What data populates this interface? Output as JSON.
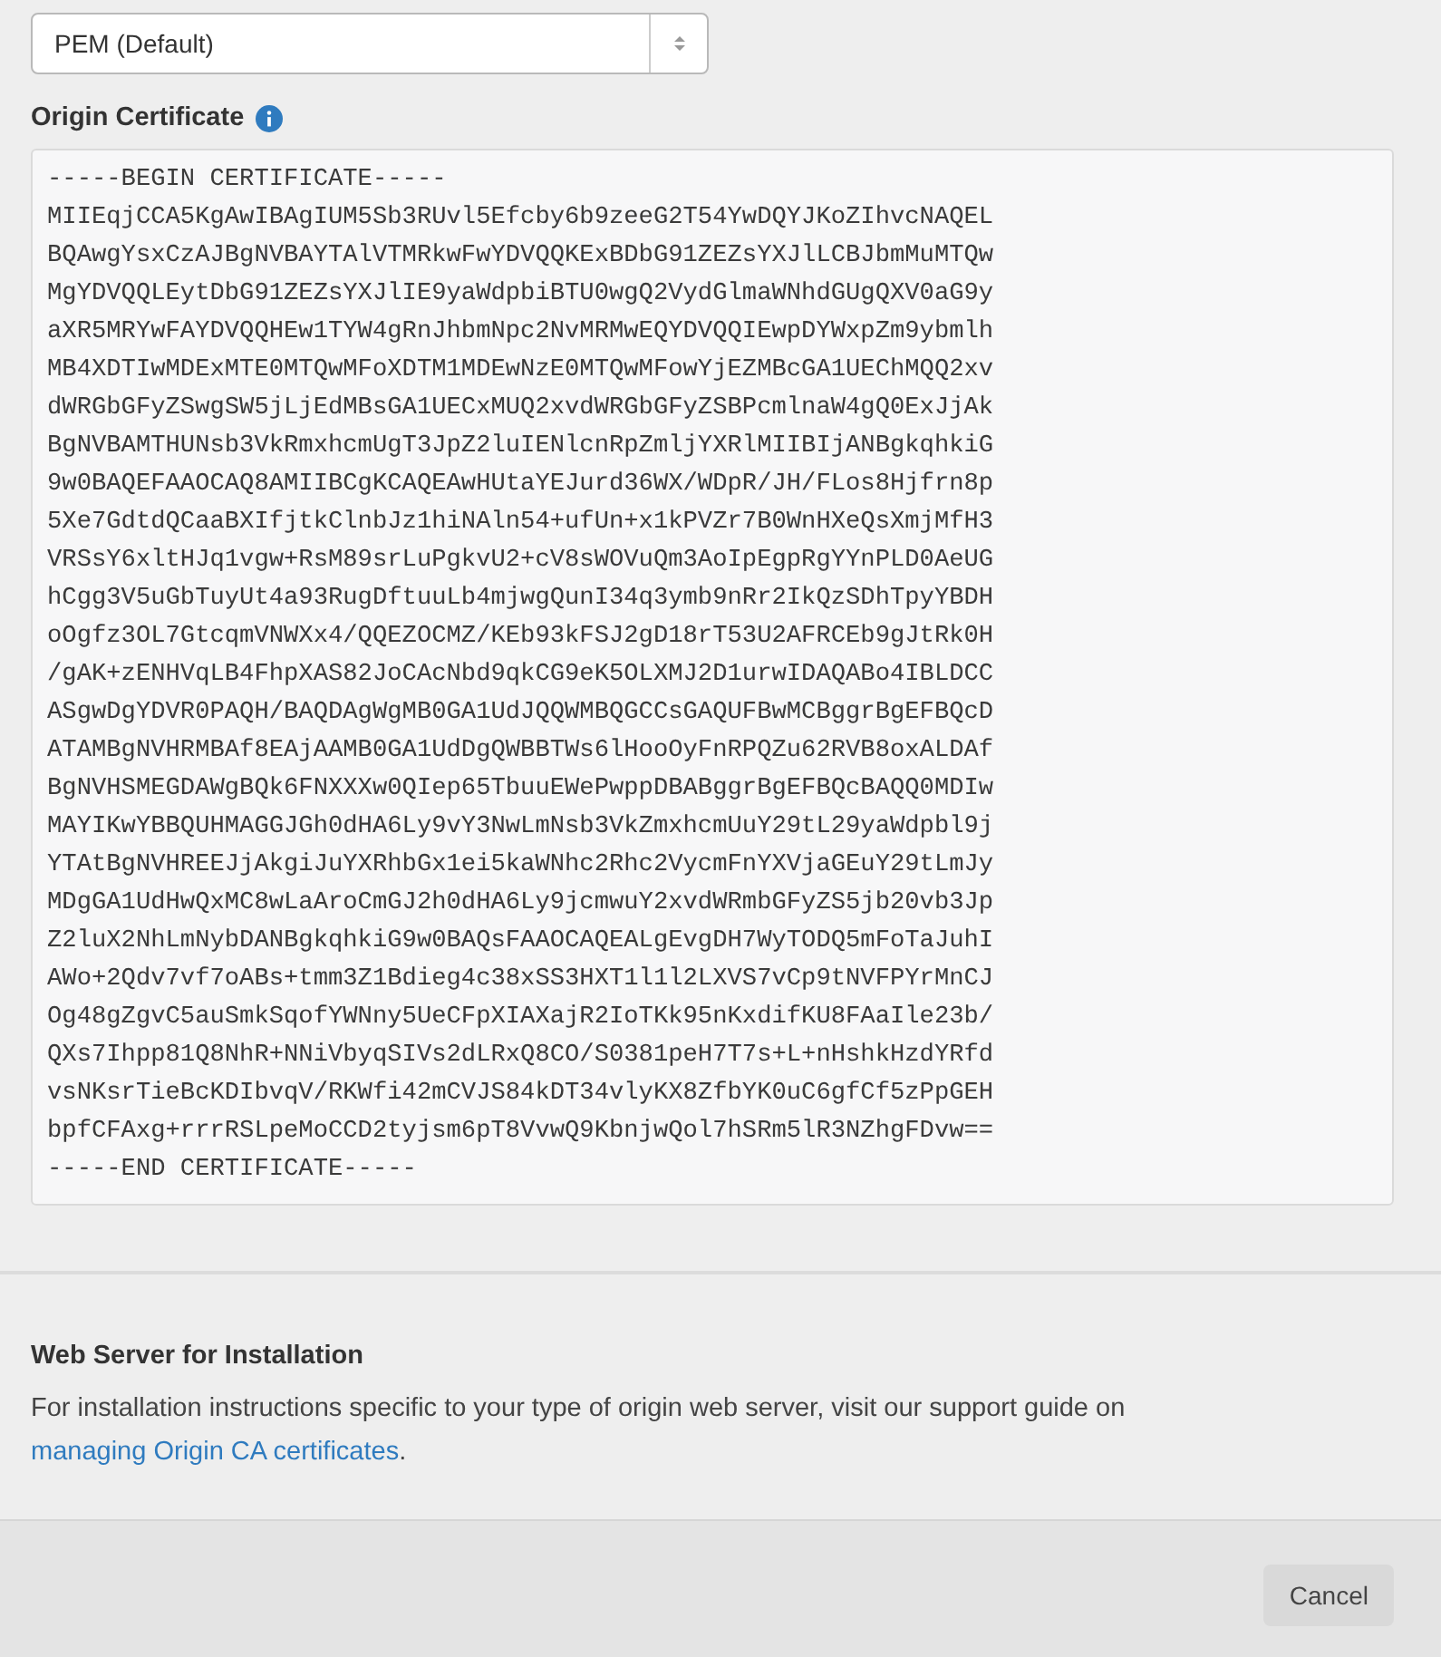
{
  "format_select": {
    "value": "PEM (Default)"
  },
  "origin_certificate": {
    "label": "Origin Certificate",
    "lines": [
      "-----BEGIN CERTIFICATE-----",
      "MIIEqjCCA5KgAwIBAgIUM5Sb3RUvl5Efcby6b9zeeG2T54YwDQYJKoZIhvcNAQEL",
      "BQAwgYsxCzAJBgNVBAYTAlVTMRkwFwYDVQQKExBDbG91ZEZsYXJlLCBJbmMuMTQw",
      "MgYDVQQLEytDbG91ZEZsYXJlIE9yaWdpbiBTU0wgQ2VydGlmaWNhdGUgQXV0aG9y",
      "aXR5MRYwFAYDVQQHEw1TYW4gRnJhbmNpc2NvMRMwEQYDVQQIEwpDYWxpZm9ybmlh",
      "MB4XDTIwMDExMTE0MTQwMFoXDTM1MDEwNzE0MTQwMFowYjEZMBcGA1UEChMQQ2xv",
      "dWRGbGFyZSwgSW5jLjEdMBsGA1UECxMUQ2xvdWRGbGFyZSBPcmlnaW4gQ0ExJjAk",
      "BgNVBAMTHUNsb3VkRmxhcmUgT3JpZ2luIENlcnRpZmljYXRlMIIBIjANBgkqhkiG",
      "9w0BAQEFAAOCAQ8AMIIBCgKCAQEAwHUtaYEJurd36WX/WDpR/JH/FLos8Hjfrn8p",
      "5Xe7GdtdQCaaBXIfjtkClnbJz1hiNAln54+ufUn+x1kPVZr7B0WnHXeQsXmjMfH3",
      "VRSsY6xltHJq1vgw+RsM89srLuPgkvU2+cV8sWOVuQm3AoIpEgpRgYYnPLD0AeUG",
      "hCgg3V5uGbTuyUt4a93RugDftuuLb4mjwgQunI34q3ymb9nRr2IkQzSDhTpyYBDH",
      "oOgfz3OL7GtcqmVNWXx4/QQEZOCMZ/KEb93kFSJ2gD18rT53U2AFRCEb9gJtRk0H",
      "/gAK+zENHVqLB4FhpXAS82JoCAcNbd9qkCG9eK5OLXMJ2D1urwIDAQABo4IBLDCC",
      "ASgwDgYDVR0PAQH/BAQDAgWgMB0GA1UdJQQWMBQGCCsGAQUFBwMCBggrBgEFBQcD",
      "ATAMBgNVHRMBAf8EAjAAMB0GA1UdDgQWBBTWs6lHooOyFnRPQZu62RVB8oxALDAf",
      "BgNVHSMEGDAWgBQk6FNXXXw0QIep65TbuuEWePwppDBABggrBgEFBQcBAQQ0MDIw",
      "MAYIKwYBBQUHMAGGJGh0dHA6Ly9vY3NwLmNsb3VkZmxhcmUuY29tL29yaWdpbl9j",
      "YTAtBgNVHREEJjAkgiJuYXRhbGx1ei5kaWNhc2Rhc2VycmFnYXVjaGEuY29tLmJy",
      "MDgGA1UdHwQxMC8wLaAroCmGJ2h0dHA6Ly9jcmwuY2xvdWRmbGFyZS5jb20vb3Jp",
      "Z2luX2NhLmNybDANBgkqhkiG9w0BAQsFAAOCAQEALgEvgDH7WyTODQ5mFoTaJuhI",
      "AWo+2Qdv7vf7oABs+tmm3Z1Bdieg4c38xSS3HXT1l1l2LXVS7vCp9tNVFPYrMnCJ",
      "Og48gZgvC5auSmkSqofYWNny5UeCFpXIAXajR2IoTKk95nKxdifKU8FAaIle23b/",
      "QXs7Ihpp81Q8NhR+NNiVbyqSIVs2dLRxQ8CO/S0381peH7T7s+L+nHshkHzdYRfd",
      "vsNKsrTieBcKDIbvqV/RKWfi42mCVJS84kDT34vlyKX8ZfbYK0uC6gfCf5zPpGEH",
      "bpfCFAxg+rrrRSLpeMoCCD2tyjsm6pT8VvwQ9KbnjwQol7hSRm5lR3NZhgFDvw==",
      "-----END CERTIFICATE-----"
    ]
  },
  "web_server_section": {
    "title": "Web Server for Installation",
    "text": "For installation instructions specific to your type of origin web server, visit our support guide on ",
    "link": "managing Origin CA certificates",
    "text_end": "."
  },
  "footer": {
    "buttons": [
      "Cancel"
    ]
  }
}
